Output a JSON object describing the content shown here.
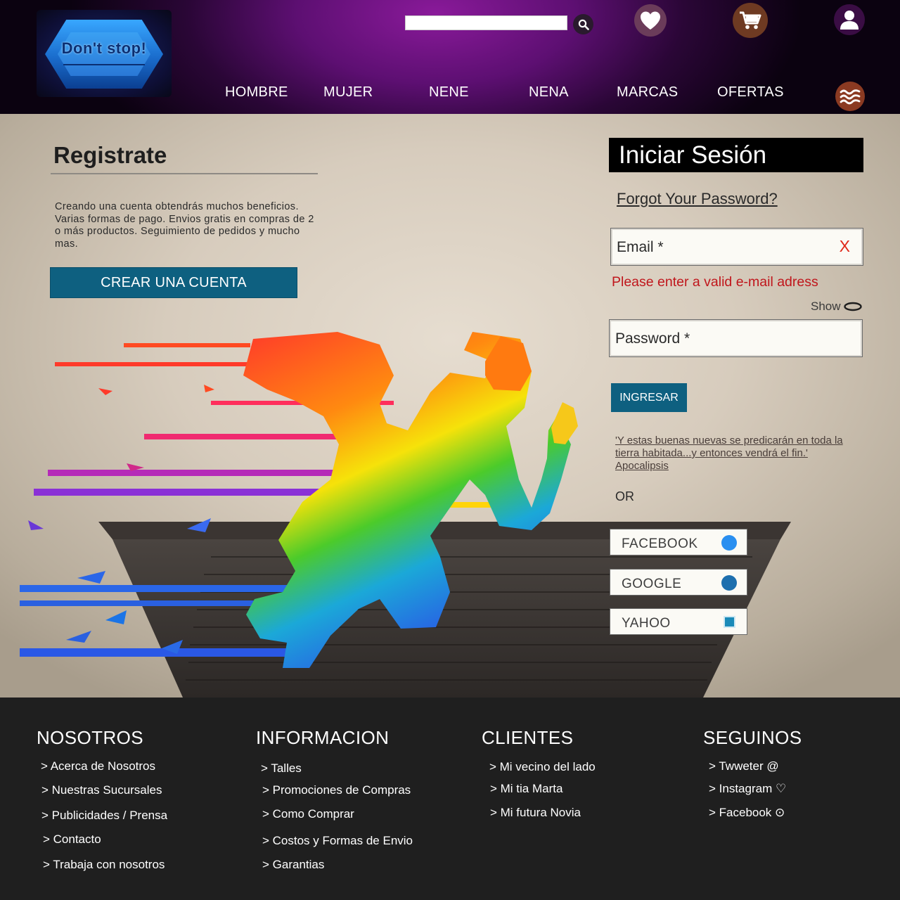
{
  "brand": {
    "logo_text": "Don't stop!"
  },
  "search": {
    "placeholder": ""
  },
  "header_icons": {
    "search": "search-icon",
    "favorites": "heart-icon",
    "cart": "cart-icon",
    "account": "user-icon",
    "menu": "waves-icon"
  },
  "nav": {
    "items": [
      "HOMBRE",
      "MUJER",
      "NENE",
      "NENA",
      "MARCAS",
      "OFERTAS"
    ]
  },
  "register": {
    "title": "Registrate",
    "text": "Creando una cuenta obtendrás muchos beneficios. Varias formas de pago. Envios gratis en compras de 2 o más productos. Seguimiento de pedidos y mucho mas.",
    "button": "CREAR UNA CUENTA"
  },
  "login": {
    "title": "Iniciar Sesión",
    "forgot": "Forgot Your Password?",
    "email_placeholder": "Email *",
    "email_clear": "X",
    "email_error": "Please enter a valid e-mail adress",
    "show_label": "Show",
    "password_placeholder": "Password *",
    "submit": "INGRESAR",
    "quote": "'Y estas buenas nuevas se predicarán en toda la tierra habitada...y entonces vendrá el fin.' Apocalipsis",
    "or": "OR",
    "social": [
      {
        "label": "FACEBOOK",
        "color": "#2a8ff0"
      },
      {
        "label": "GOOGLE",
        "color": "#1e6fae"
      },
      {
        "label": "YAHOO",
        "color": "#1a8ab8"
      }
    ]
  },
  "footer": {
    "columns": [
      {
        "title": "NOSOTROS",
        "links": [
          "> Acerca de Nosotros",
          "> Nuestras Sucursales",
          "> Publicidades / Prensa",
          "> Contacto",
          "> Trabaja con nosotros"
        ]
      },
      {
        "title": "INFORMACION",
        "links": [
          "> Talles",
          "> Promociones de Compras",
          "> Como Comprar",
          "> Costos y Formas de Envio",
          "> Garantias"
        ]
      },
      {
        "title": "CLIENTES",
        "links": [
          "> Mi vecino del lado",
          "> Mi tia Marta",
          "> Mi futura Novia"
        ]
      },
      {
        "title": "SEGUINOS",
        "links": [
          "> Twweter @",
          "> Instagram ♡",
          "> Facebook ⊙"
        ]
      }
    ]
  },
  "colors": {
    "header_purple": "#7a1590",
    "primary_button": "#0e6080",
    "error": "#c0161c",
    "footer_bg": "#1f1f1f"
  }
}
